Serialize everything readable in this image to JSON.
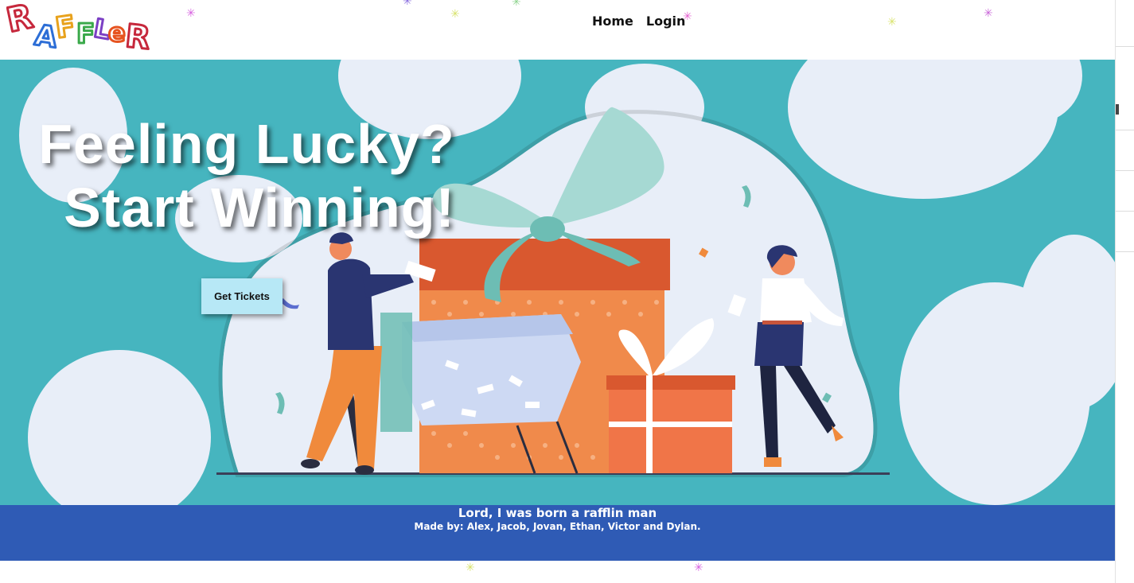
{
  "header": {
    "logo_text": "RAFFLER",
    "nav": [
      {
        "label": "Home"
      },
      {
        "label": "Login"
      }
    ]
  },
  "hero": {
    "title_line1": "Feeling Lucky?",
    "title_line2": "Start Winning!",
    "cta_label": "Get Tickets"
  },
  "footer": {
    "tagline": "Lord, I was born a rafflin man",
    "credits": "Made by: Alex, Jacob, Jovan, Ethan, Victor and Dylan."
  },
  "colors": {
    "hero_bg": "#46b5bf",
    "cloud": "#e8eef8",
    "cta_bg": "#b7e8f6",
    "footer_bg": "#2f5bb5",
    "gift_orange": "#f08a4b",
    "gift_dark": "#d9542f",
    "ribbon": "#7ecbc0"
  }
}
